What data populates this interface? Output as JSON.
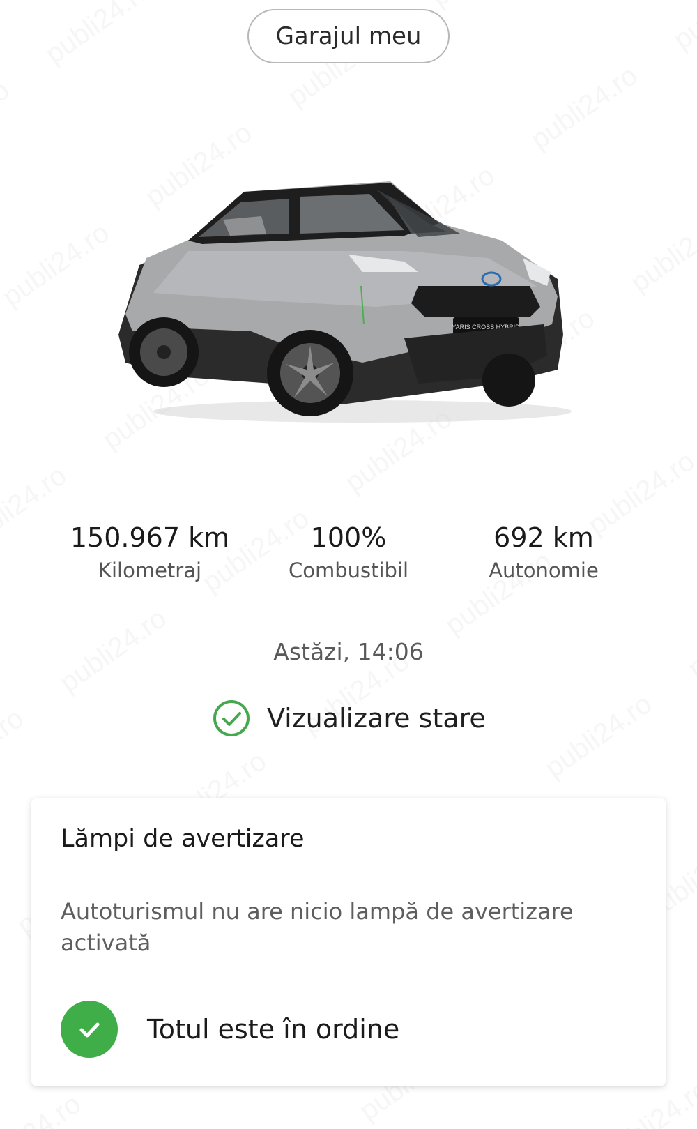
{
  "header": {
    "garage_button_label": "Garajul meu"
  },
  "vehicle": {
    "model_badge": "YARIS CROSS HYBRID",
    "body_color": "#a7a9aa"
  },
  "stats": [
    {
      "value": "150.967 km",
      "label": "Kilometraj"
    },
    {
      "value": "100%",
      "label": "Combustibil"
    },
    {
      "value": "692 km",
      "label": "Autonomie"
    }
  ],
  "last_update": "Astăzi, 14:06",
  "status_link": {
    "icon": "check-circle-outline-icon",
    "label": "Vizualizare stare"
  },
  "warning_card": {
    "title": "Lămpi de avertizare",
    "description": "Autoturismul nu are nicio lampă de avertizare activată",
    "status_icon": "check-circle-filled-icon",
    "status_text": "Totul este în ordine"
  },
  "watermark_text": "publi24.ro",
  "colors": {
    "success_green": "#3fae49",
    "success_outline_green": "#45a84f",
    "text_muted": "#5e5e5e"
  }
}
